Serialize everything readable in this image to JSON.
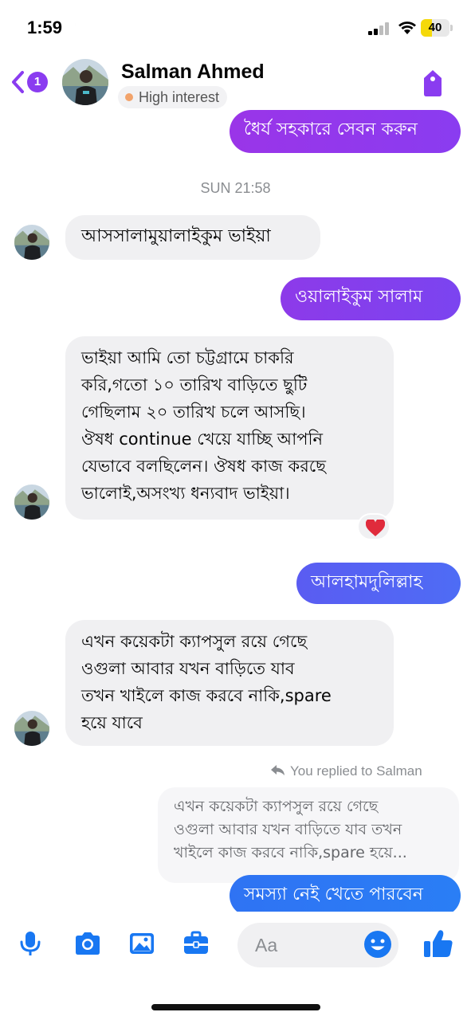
{
  "status_bar": {
    "time": "1:59",
    "battery_percent": 40,
    "battery_label": "40"
  },
  "header": {
    "unread_count": "1",
    "contact_name": "Salman Ahmed",
    "lead_status": "High interest"
  },
  "messages": [
    {
      "id": "m0",
      "direction": "outgoing",
      "text": "ধৈর্য সহকারে সেবন করুন"
    },
    {
      "id": "m1",
      "direction": "incoming",
      "text": "আসসালামুয়ালাইকুম ভাইয়া"
    },
    {
      "id": "m2",
      "direction": "outgoing",
      "text": "ওয়ালাইকুম সালাম"
    },
    {
      "id": "m3",
      "direction": "incoming",
      "lines": [
        "ভাইয়া আমি তো চট্টগ্রামে চাকরি",
        "করি,গতো ১০ তারিখ বাড়িতে ছুটি",
        "গেছিলাম ২০ তারিখ চলে আসছি।",
        "ঔষধ continue খেয়ে যাচ্ছি আপনি",
        "যেভাবে বলছিলেন। ঔষধ কাজ করছে",
        "ভালোই,অসংখ্য ধন্যবাদ ভাইয়া।"
      ],
      "reaction": "heart"
    },
    {
      "id": "m4",
      "direction": "outgoing",
      "text": "আলহামদুলিল্লাহ"
    },
    {
      "id": "m5",
      "direction": "incoming",
      "lines": [
        "এখন কয়েকটা ক্যাপসুল রয়ে গেছে",
        "ওগুলা আবার যখন বাড়িতে যাব",
        "তখন খাইলে কাজ করবে নাকি,spare",
        "হয়ে যাবে"
      ]
    },
    {
      "id": "m6",
      "direction": "outgoing",
      "text": "সমস্যা নেই খেতে পারবেন"
    }
  ],
  "timestamp": "SUN 21:58",
  "reply": {
    "label": "You replied to Salman",
    "quoted_text": "এখন কয়েকটা ক্যাপসুল রয়ে গেছে\nওগুলা আবার যখন বাড়িতে যাব তখন\nখাইলে কাজ করবে নাকি,spare হয়ে..."
  },
  "composer": {
    "placeholder": "Aa",
    "tools": [
      "microphone-icon",
      "camera-icon",
      "gallery-icon",
      "briefcase-icon"
    ]
  },
  "colors": {
    "accent": "#8a3cf0",
    "bubble_incoming": "#f0f0f2",
    "icon_blue": "#1877f2"
  }
}
